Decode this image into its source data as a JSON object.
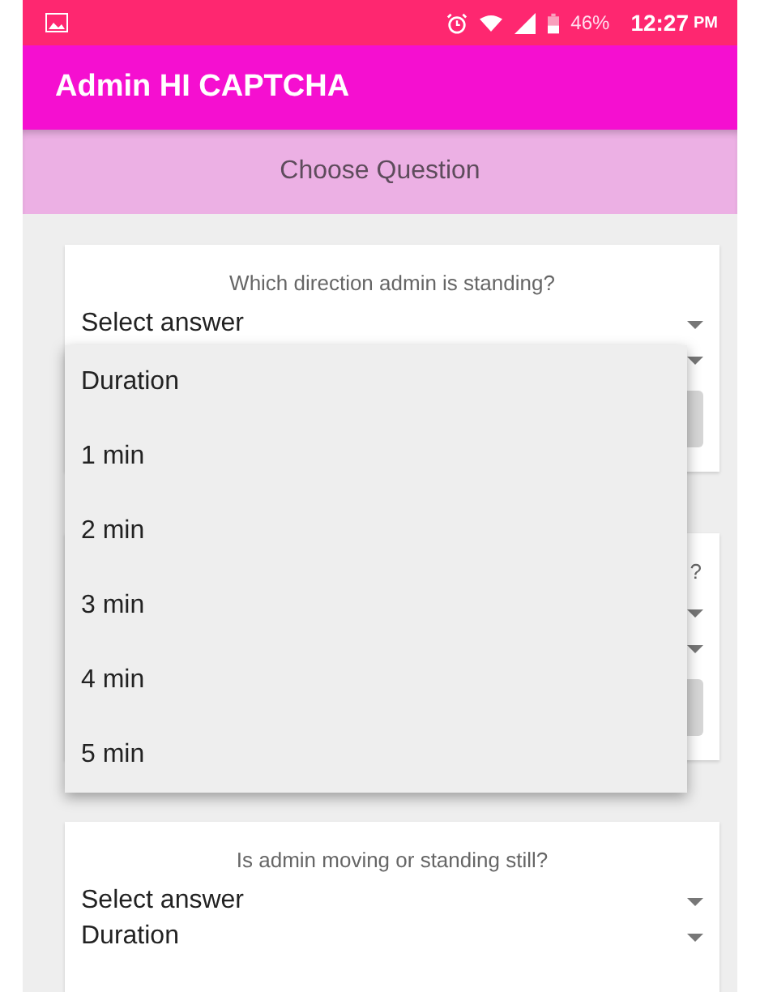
{
  "status_bar": {
    "battery": "46%",
    "time": "12:27",
    "meridiem": "PM"
  },
  "app_bar": {
    "title": "Admin HI CAPTCHA"
  },
  "header": {
    "label": "Choose Question"
  },
  "cards": [
    {
      "question": "Which direction admin is standing?",
      "dropdowns": [
        {
          "kind": "spinner",
          "value": "Select answer"
        },
        {
          "kind": "spinner",
          "options": [
            "Duration",
            "1 min",
            "2 min",
            "3 min",
            "4 min",
            "5 min"
          ]
        }
      ],
      "button": true
    },
    {
      "question_tail": "?",
      "dropdowns": [
        {
          "kind": "spinner"
        },
        {
          "kind": "spinner"
        }
      ],
      "button": true
    },
    {
      "question": "Is admin moving or standing still?",
      "dropdowns": [
        {
          "kind": "spinner",
          "value": "Select answer"
        },
        {
          "kind": "spinner",
          "value": "Duration"
        }
      ]
    }
  ]
}
